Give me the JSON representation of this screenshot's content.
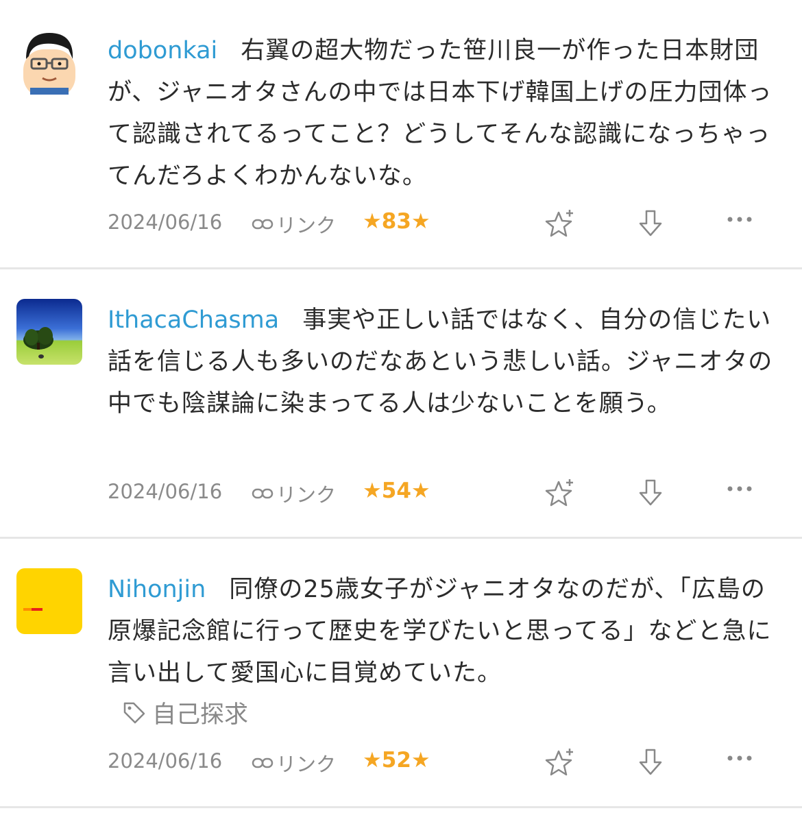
{
  "comments": [
    {
      "user": "dobonkai",
      "text": "右翼の超大物だった笹川良一が作った日本財団が、ジャニオタさんの中では日本下げ韓国上げの圧力団体って認識されてるってこと？どうしてそんな認識になっちゃってんだろよくわかんないな。",
      "date": "2024/06/16",
      "link": "リンク",
      "stars": "★83★"
    },
    {
      "user": "IthacaChasma",
      "text": "事実や正しい話ではなく、自分の信じたい話を信じる人も多いのだなあという悲しい話。ジャニオタの中でも陰謀論に染まってる人は少ないことを願う。",
      "date": "2024/06/16",
      "link": "リンク",
      "stars": "★54★"
    },
    {
      "user": "Nihonjin",
      "text": "同僚の25歳女子がジャニオタなのだが、「広島の原爆記念館に行って歴史を学びたいと思ってる」などと急に言い出して愛国心に目覚めていた。",
      "tag": "自己探求",
      "date": "2024/06/16",
      "link": "リンク",
      "stars": "★52★"
    }
  ],
  "colors": {
    "username": "#2f9bd3",
    "star": "#f5a623",
    "meta": "#8a8a8a",
    "separator": "#e6e6e6"
  },
  "icons": [
    "link-icon",
    "add-star-icon",
    "down-arrow-icon",
    "more-icon",
    "tag-icon"
  ]
}
